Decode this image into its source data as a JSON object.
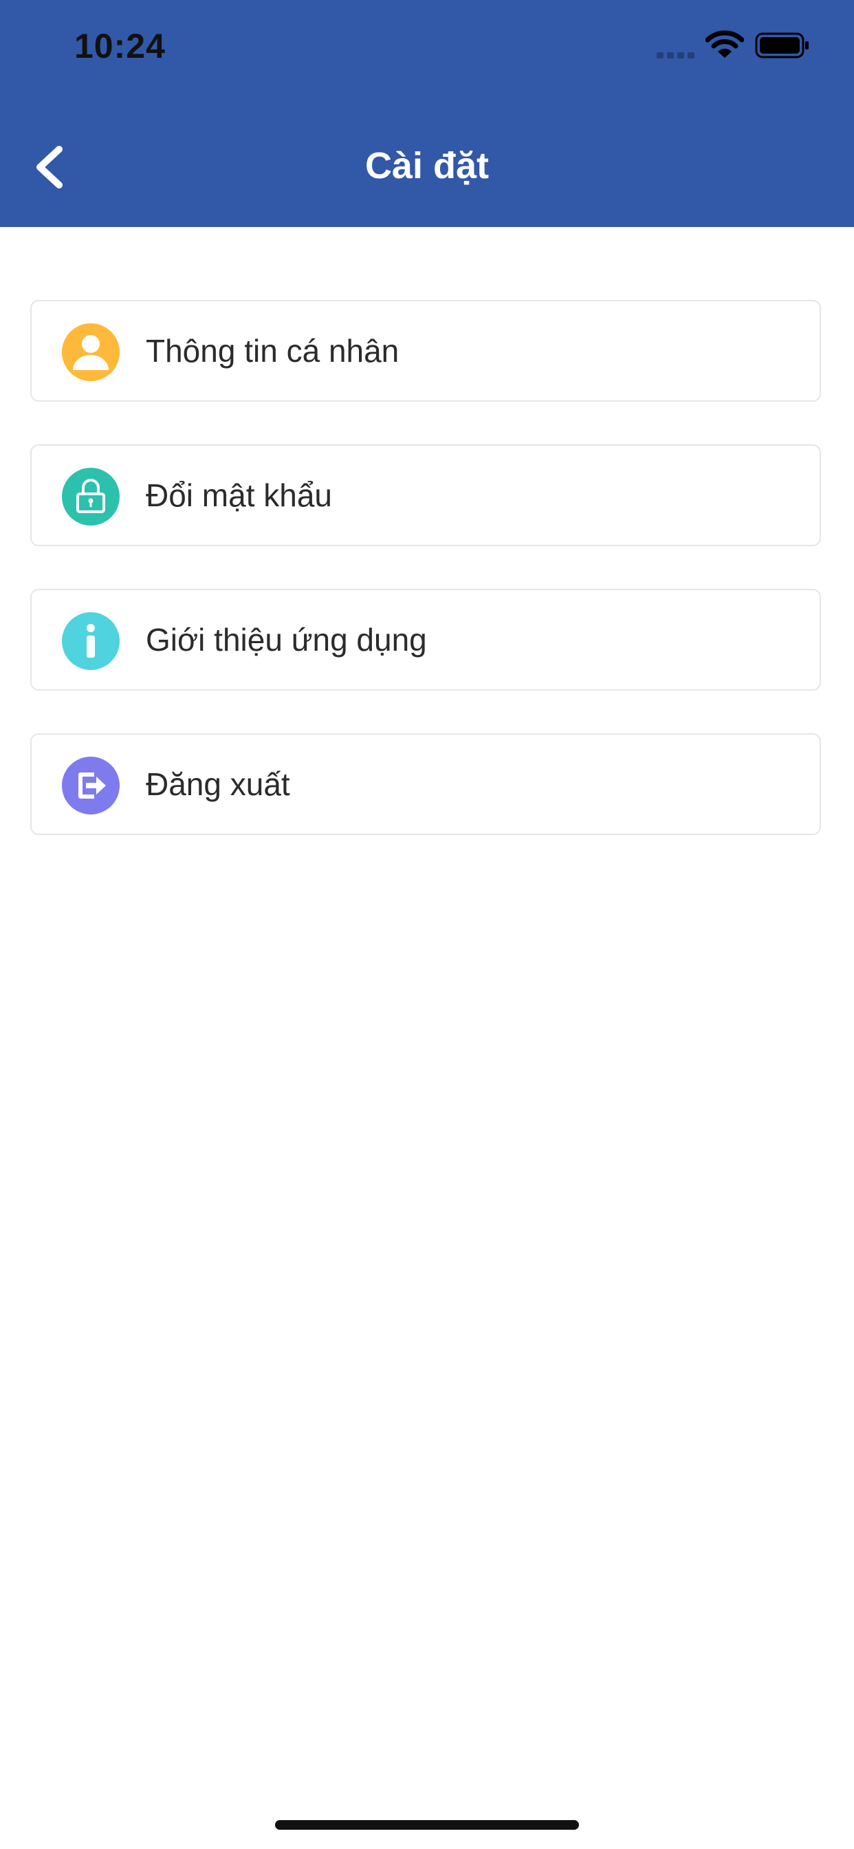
{
  "status_bar": {
    "time": "10:24",
    "icons": [
      "signal-icon",
      "wifi-icon",
      "battery-icon"
    ]
  },
  "header": {
    "title": "Cài đặt",
    "back_icon": "chevron-left-icon",
    "background": "#3258A8"
  },
  "menu": {
    "items": [
      {
        "label": "Thông tin cá nhân",
        "icon": "user-icon",
        "icon_color": "#FFB93A"
      },
      {
        "label": "Đổi mật khẩu",
        "icon": "lock-icon",
        "icon_color": "#2BC1AD"
      },
      {
        "label": "Giới thiệu ứng dụng",
        "icon": "info-icon",
        "icon_color": "#4FD3DE"
      },
      {
        "label": "Đăng xuất",
        "icon": "logout-icon",
        "icon_color": "#7E7BEF"
      }
    ]
  }
}
